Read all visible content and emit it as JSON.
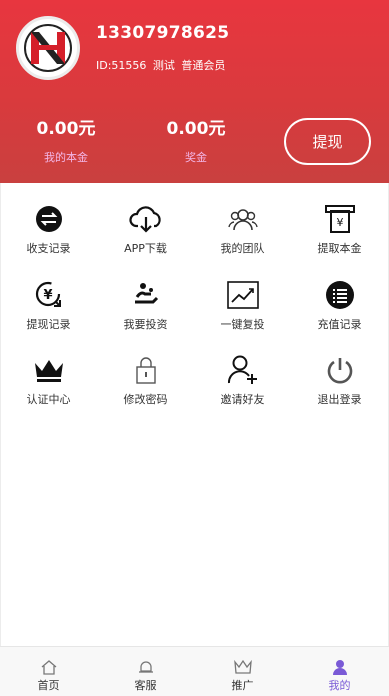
{
  "user": {
    "phone": "13307978625",
    "id_text": "ID:51556",
    "name": "测试",
    "level": "普通会员"
  },
  "stats": [
    {
      "amount": "0.00元",
      "label": "我的本金"
    },
    {
      "amount": "0.00元",
      "label": "奖金"
    }
  ],
  "withdraw_label": "提现",
  "menu": [
    {
      "label": "收支记录",
      "icon": "exchange-icon"
    },
    {
      "label": "APP下载",
      "icon": "cloud-download-icon"
    },
    {
      "label": "我的团队",
      "icon": "team-icon"
    },
    {
      "label": "提取本金",
      "icon": "atm-yen-icon"
    },
    {
      "label": "提现记录",
      "icon": "yen-refresh-icon"
    },
    {
      "label": "我要投资",
      "icon": "invest-hand-icon"
    },
    {
      "label": "一键复投",
      "icon": "trend-chart-icon"
    },
    {
      "label": "充值记录",
      "icon": "list-circle-icon"
    },
    {
      "label": "认证中心",
      "icon": "crown-icon"
    },
    {
      "label": "修改密码",
      "icon": "lock-icon"
    },
    {
      "label": "邀请好友",
      "icon": "add-user-icon"
    },
    {
      "label": "退出登录",
      "icon": "power-icon"
    }
  ],
  "tabs": [
    {
      "label": "首页",
      "icon": "home-icon"
    },
    {
      "label": "客服",
      "icon": "bell-icon"
    },
    {
      "label": "推广",
      "icon": "crown-outline-icon"
    },
    {
      "label": "我的",
      "icon": "user-icon",
      "active": true
    }
  ],
  "colors": {
    "header": "#e8363f",
    "tab_active": "#7a5ad6"
  }
}
